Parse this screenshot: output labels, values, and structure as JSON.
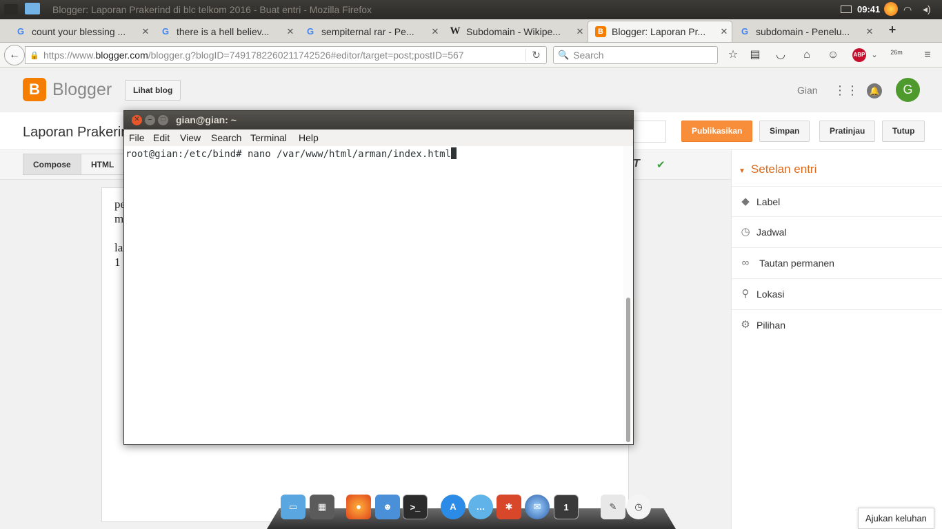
{
  "os": {
    "window_title": "Blogger: Laporan Prakerind di blc telkom 2016 - Buat entri - Mozilla Firefox",
    "clock": "09:41"
  },
  "tabs": [
    {
      "label": "count your blessing ...",
      "favicon": "G",
      "type": "google"
    },
    {
      "label": "there is a hell believ...",
      "favicon": "G",
      "type": "google"
    },
    {
      "label": "sempiternal rar - Pe...",
      "favicon": "G",
      "type": "google"
    },
    {
      "label": "Subdomain - Wikipe...",
      "favicon": "W",
      "type": "wikipedia"
    },
    {
      "label": "Blogger: Laporan Pr...",
      "favicon": "B",
      "type": "blogger",
      "active": true
    },
    {
      "label": "subdomain - Penelu...",
      "favicon": "G",
      "type": "google"
    }
  ],
  "navbar": {
    "url_prefix": "https://www.",
    "url_domain": "blogger.com",
    "url_rest": "/blogger.g?blogID=7491782260211742526#editor/target=post;postID=567",
    "search_placeholder": "Search",
    "badge_text": "26m"
  },
  "blogger": {
    "brand": "Blogger",
    "view_blog": "Lihat blog",
    "user_name": "Gian",
    "avatar_letter": "G",
    "post_title": "Laporan Prakerind di blc telkom 2016",
    "buttons": {
      "publish": "Publikasikan",
      "save": "Simpan",
      "preview": "Pratinjau",
      "close": "Tutup"
    },
    "modes": {
      "compose": "Compose",
      "html": "HTML"
    },
    "editor_lines": [
      "pe",
      "m",
      "",
      "la",
      "1"
    ]
  },
  "sidebar": {
    "header": "Setelan entri",
    "items": [
      {
        "label": "Label",
        "icon": "tag-icon"
      },
      {
        "label": "Jadwal",
        "icon": "clock-icon"
      },
      {
        "label": "Tautan permanen",
        "icon": "link-icon"
      },
      {
        "label": "Lokasi",
        "icon": "location-pin-icon"
      },
      {
        "label": "Pilihan",
        "icon": "gear-icon"
      }
    ]
  },
  "terminal": {
    "title": "gian@gian: ~",
    "menu": [
      "File",
      "Edit",
      "View",
      "Search",
      "Terminal",
      "Help"
    ],
    "prompt_line": "root@gian:/etc/bind# nano /var/www/html/arman/index.html"
  },
  "dock": {
    "terminal_badge": "1"
  },
  "feedback_button": "Ajukan keluhan"
}
